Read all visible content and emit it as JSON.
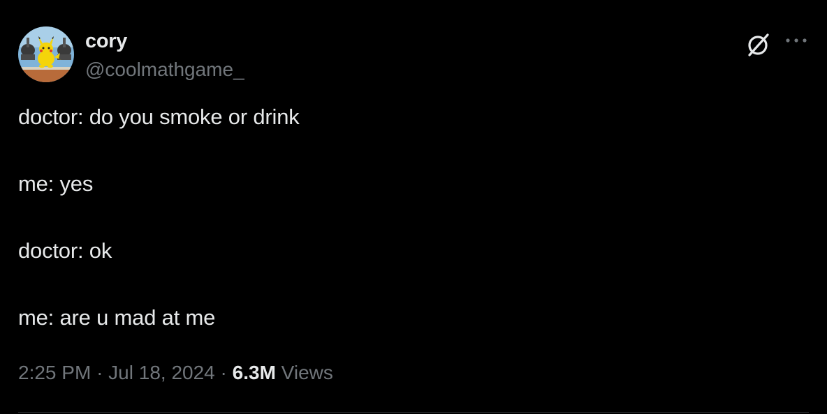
{
  "author": {
    "display_name": "cory",
    "handle": "@coolmathgame_",
    "avatar_icon": "pikachu-avatar"
  },
  "actions": {
    "grok_icon": "grok-icon",
    "more_icon": "more-dots-icon"
  },
  "tweet": {
    "lines": [
      "doctor: do you smoke or drink",
      "me: yes",
      "doctor: ok",
      "me: are u mad at me"
    ]
  },
  "meta": {
    "time": "2:25 PM",
    "separator": "·",
    "date": "Jul 18, 2024",
    "views_count": "6.3M",
    "views_label": "Views"
  },
  "colors": {
    "background": "#000000",
    "primary_text": "#e7e9ea",
    "secondary_text": "#71767b",
    "divider": "#2f3336"
  }
}
